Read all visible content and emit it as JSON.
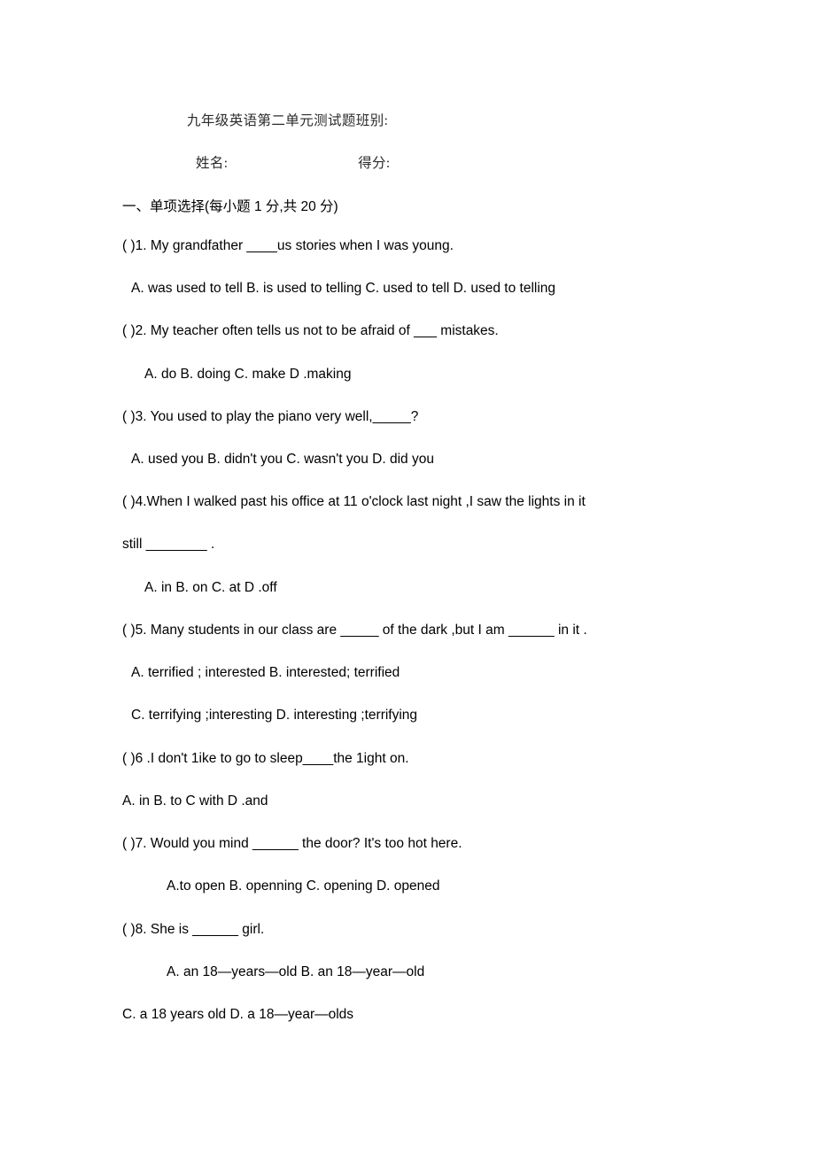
{
  "document": {
    "title": "九年级英语第二单元测试题班别:",
    "name_label": "姓名:",
    "score_label": "得分:",
    "section_heading": "一、单项选择(每小题 1 分,共 20 分)"
  },
  "questions": [
    {
      "stem": "(   )1. My grandfather ____us stories when I was young.",
      "options_rows": [
        "A. was used to tell   B. is used to telling  C. used to tell   D. used to telling"
      ]
    },
    {
      "stem": "(   )2. My teacher often tells us not to be afraid of   ___ mistakes.",
      "options_rows": [
        "A. do     B. doing    C. make     D .making"
      ]
    },
    {
      "stem": "(   )3. You used to play the piano very well,_____?",
      "options_rows": [
        "A. used you   B. didn't you   C. wasn't you   D. did you"
      ]
    },
    {
      "stem": "(   )4.When I walked past his office at 11 o'clock last night ,I saw the lights in it",
      "continuation": "still ________ .",
      "options_rows": [
        "A. in     B. on      C. at     D .off"
      ]
    },
    {
      "stem": "(   )5. Many students in our class are _____ of the dark ,but I am ______ in it .",
      "options_rows": [
        "A. terrified ; interested      B. interested; terrified",
        "C. terrifying ;interesting   D. interesting ;terrifying"
      ]
    },
    {
      "stem": "(   )6 .I don't 1ike to go to sleep____the 1ight on.",
      "options_rows": [
        "A. in    B. to     C with   D .and"
      ]
    },
    {
      "stem": "(   )7. Would you mind  ______     the door? It's too hot here.",
      "options_rows": [
        "A.to open        B. openning      C. opening      D. opened"
      ]
    },
    {
      "stem": "(   )8. She is  ______   girl.",
      "options_rows": [
        "A. an 18—years—old       B. an 18—year—old",
        "C. a 18 years old           D. a 18—year—olds"
      ]
    }
  ]
}
